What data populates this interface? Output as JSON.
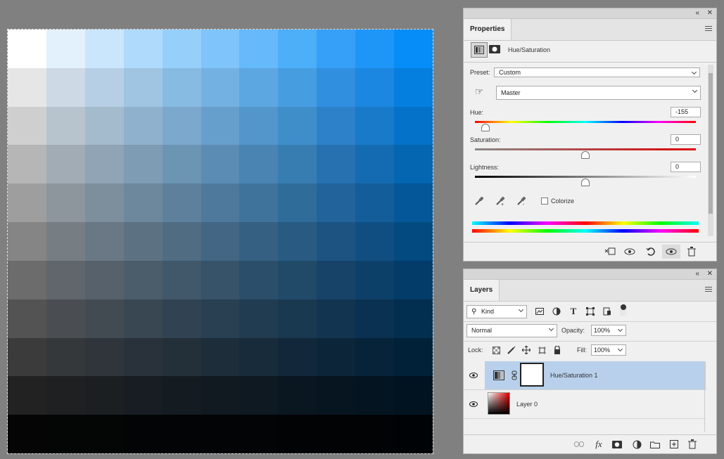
{
  "canvas": {
    "swatch_top_row": [
      "#ffffff",
      "#e3f1fd",
      "#cae6fd",
      "#b0dafc",
      "#97cffb",
      "#7fc4fb",
      "#66b9fa",
      "#4eaff9",
      "#369ff8",
      "#1e96f8",
      "#068df7"
    ],
    "swatch_left_col": [
      "#ffffff",
      "#e6e6e6",
      "#cfcfcf",
      "#b6b6b6",
      "#9e9e9e",
      "#858585",
      "#6c6c6c",
      "#535353",
      "#3b3b3b",
      "#222222",
      "#050505"
    ]
  },
  "properties": {
    "tab_label": "Properties",
    "adjustment_title": "Hue/Saturation",
    "preset_label": "Preset:",
    "preset_value": "Custom",
    "channel_value": "Master",
    "hue_label": "Hue:",
    "hue_value": "-155",
    "hue_fraction": 0.07,
    "saturation_label": "Saturation:",
    "saturation_value": "0",
    "saturation_fraction": 0.5,
    "lightness_label": "Lightness:",
    "lightness_value": "0",
    "lightness_fraction": 0.5,
    "colorize_label": "Colorize",
    "colorize_checked": false
  },
  "layers": {
    "tab_label": "Layers",
    "filter_value": "Kind",
    "blend_mode": "Normal",
    "opacity_label": "Opacity:",
    "opacity_value": "100%",
    "lock_label": "Lock:",
    "fill_label": "Fill:",
    "fill_value": "100%",
    "items": [
      {
        "name": "Hue/Saturation 1",
        "selected": true,
        "visible": true
      },
      {
        "name": "Layer 0",
        "selected": false,
        "visible": true
      }
    ]
  },
  "colors": {
    "selected_row": "#b8d0eb",
    "accent": "#1e96f8"
  },
  "icons": {
    "collapse": "double-chevron-icon",
    "close": "close-icon",
    "menu": "panel-menu-icon"
  }
}
